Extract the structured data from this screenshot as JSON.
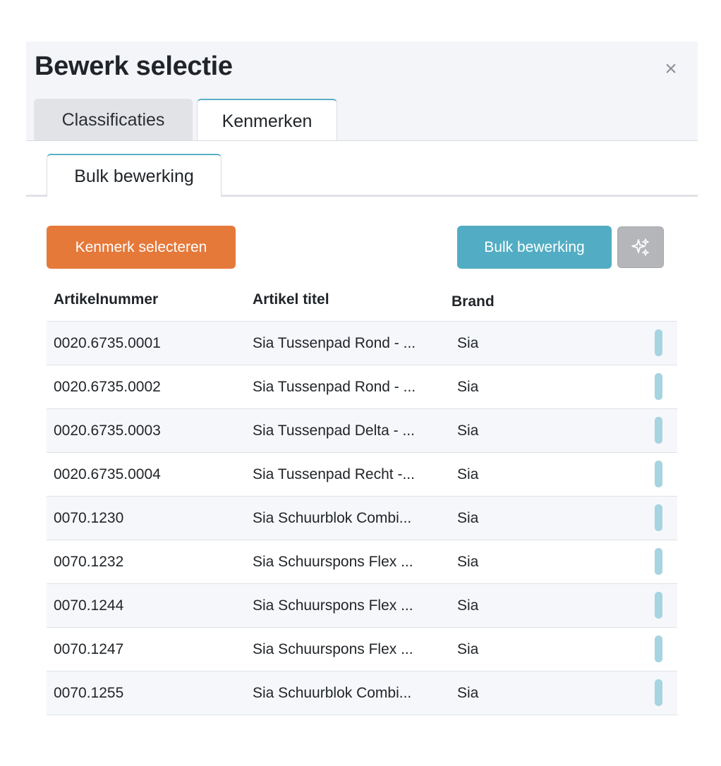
{
  "modal": {
    "title": "Bewerk selectie",
    "close_symbol": "×",
    "tabs": [
      {
        "label": "Classificaties",
        "active": false
      },
      {
        "label": "Kenmerken",
        "active": true
      }
    ],
    "subtabs": [
      {
        "label": "Bulk bewerking",
        "active": true
      }
    ]
  },
  "toolbar": {
    "select_label": "Kenmerk selecteren",
    "bulk_label": "Bulk bewerking",
    "magic_icon": "sparkles-icon"
  },
  "table": {
    "headers": {
      "article_number": "Artikelnummer",
      "article_title": "Artikel titel",
      "brand": "Brand"
    },
    "rows": [
      {
        "number": "0020.6735.0001",
        "title": "Sia Tussenpad Rond - ...",
        "brand": "Sia"
      },
      {
        "number": "0020.6735.0002",
        "title": "Sia Tussenpad Rond - ...",
        "brand": "Sia"
      },
      {
        "number": "0020.6735.0003",
        "title": "Sia Tussenpad Delta - ...",
        "brand": "Sia"
      },
      {
        "number": "0020.6735.0004",
        "title": "Sia Tussenpad Recht -...",
        "brand": "Sia"
      },
      {
        "number": "0070.1230",
        "title": "Sia Schuurblok Combi...",
        "brand": "Sia"
      },
      {
        "number": "0070.1232",
        "title": "Sia Schuurspons Flex ...",
        "brand": "Sia"
      },
      {
        "number": "0070.1244",
        "title": "Sia Schuurspons Flex ...",
        "brand": "Sia"
      },
      {
        "number": "0070.1247",
        "title": "Sia Schuurspons Flex ...",
        "brand": "Sia"
      },
      {
        "number": "0070.1255",
        "title": "Sia Schuurblok Combi...",
        "brand": "Sia"
      }
    ]
  },
  "colors": {
    "accent_orange": "#e5793a",
    "accent_teal": "#52adc4",
    "handle": "#a6d4e0",
    "header_bg": "#f4f5f9"
  }
}
